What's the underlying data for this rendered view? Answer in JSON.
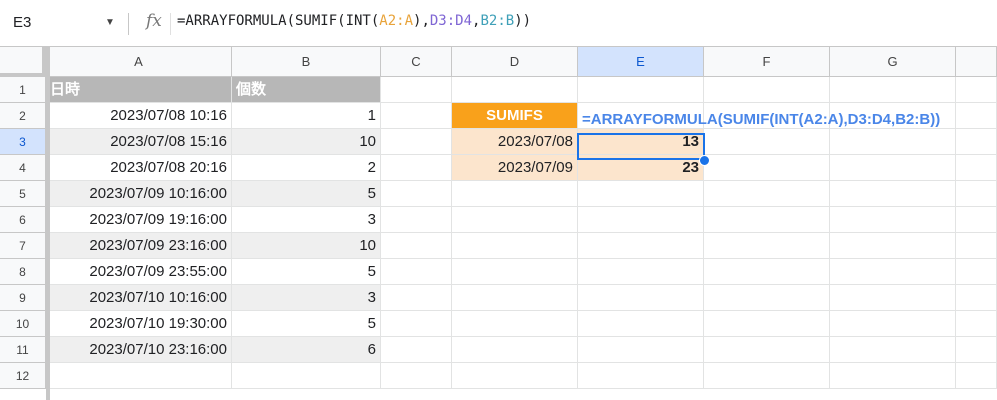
{
  "formula_bar": {
    "cell_ref": "E3",
    "fx_label": "fx",
    "formula_parts": [
      "=ARRAYFORMULA(SUMIF(INT(",
      "A2:A",
      "),",
      "D3:D4",
      ",",
      "B2:B",
      "))"
    ]
  },
  "columns": [
    "A",
    "B",
    "C",
    "D",
    "E",
    "F",
    "G"
  ],
  "rows": [
    "1",
    "2",
    "3",
    "4",
    "5",
    "6",
    "7",
    "8",
    "9",
    "10",
    "11",
    "12"
  ],
  "table": {
    "headers": [
      "日時",
      "個数"
    ],
    "records": [
      [
        "2023/07/08 10:16",
        "1"
      ],
      [
        "2023/07/08 15:16",
        "10"
      ],
      [
        "2023/07/08 20:16",
        "2"
      ],
      [
        "2023/07/09 10:16:00",
        "5"
      ],
      [
        "2023/07/09 19:16:00",
        "3"
      ],
      [
        "2023/07/09 23:16:00",
        "10"
      ],
      [
        "2023/07/09 23:55:00",
        "5"
      ],
      [
        "2023/07/10 10:16:00",
        "3"
      ],
      [
        "2023/07/10 19:30:00",
        "5"
      ],
      [
        "2023/07/10 23:16:00",
        "6"
      ]
    ]
  },
  "summary": {
    "header": "SUMIFS",
    "formula_display": "=ARRAYFORMULA(SUMIF(INT(A2:A),D3:D4,B2:B))",
    "rows": [
      [
        "2023/07/08",
        "13"
      ],
      [
        "2023/07/09",
        "23"
      ]
    ]
  },
  "colors": {
    "selection": "#1a73e8",
    "sumifs_header": "#f9a11b",
    "peach": "#fce5cd",
    "table_header": "#b7b7b7",
    "formula_text": "#4a86e8"
  }
}
